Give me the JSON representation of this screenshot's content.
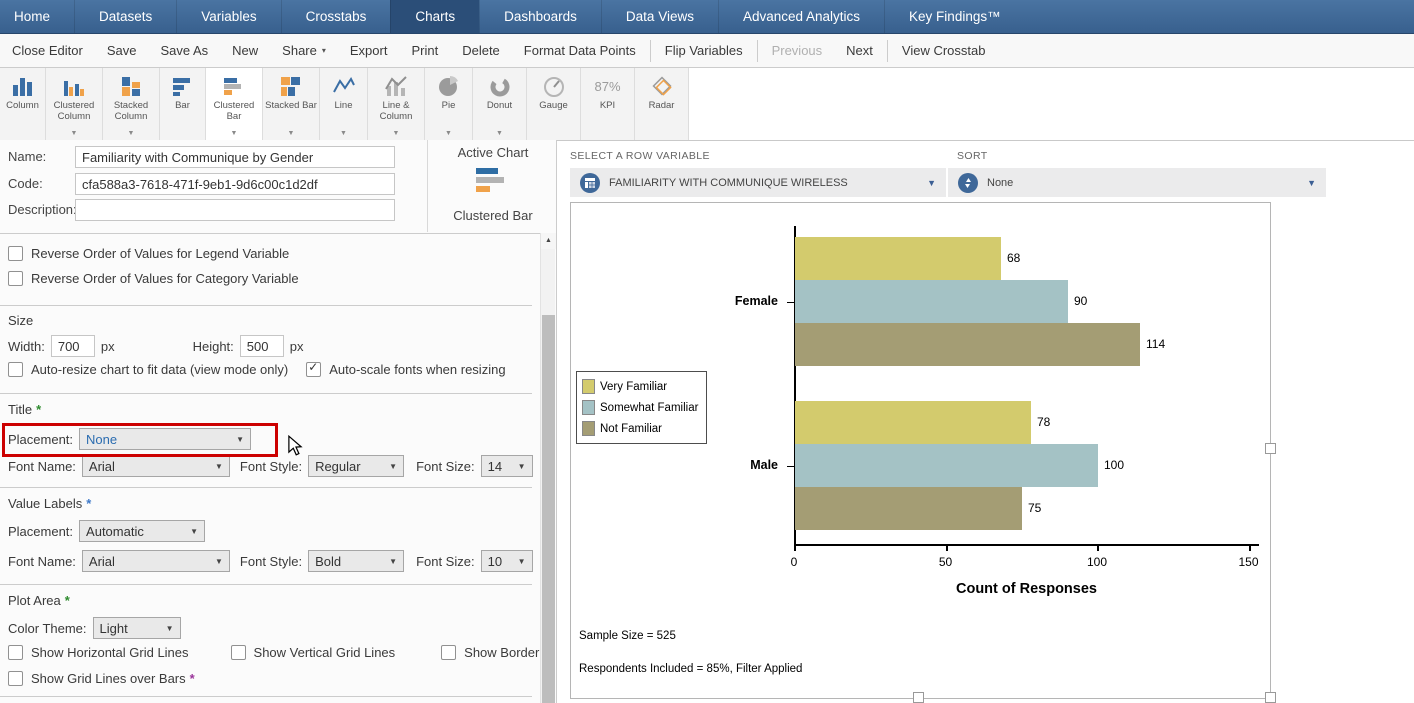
{
  "nav": {
    "items": [
      {
        "label": "Home",
        "active": false
      },
      {
        "label": "Datasets",
        "active": false
      },
      {
        "label": "Variables",
        "active": false
      },
      {
        "label": "Crosstabs",
        "active": false
      },
      {
        "label": "Charts",
        "active": true
      },
      {
        "label": "Dashboards",
        "active": false
      },
      {
        "label": "Data Views",
        "active": false
      },
      {
        "label": "Advanced Analytics",
        "active": false
      },
      {
        "label": "Key Findings™",
        "active": false
      }
    ]
  },
  "menubar": {
    "items": [
      {
        "label": "Close Editor"
      },
      {
        "label": "Save"
      },
      {
        "label": "Save As"
      },
      {
        "label": "New"
      },
      {
        "label": "Share",
        "dropdown": true
      },
      {
        "label": "Export"
      },
      {
        "label": "Print"
      },
      {
        "label": "Delete"
      },
      {
        "label": "Format Data Points"
      },
      {
        "label": "Flip Variables",
        "sep_before": true
      },
      {
        "label": "Previous",
        "disabled": true,
        "sep_before": true
      },
      {
        "label": "Next"
      },
      {
        "label": "View Crosstab",
        "sep_before": true
      }
    ]
  },
  "chart_types": {
    "buttons": [
      {
        "label": "Column",
        "icon": "column-icon",
        "width": 46
      },
      {
        "label": "Clustered Column",
        "icon": "clustered-column-icon",
        "dropdown": true,
        "width": 57
      },
      {
        "label": "Stacked Column",
        "icon": "stacked-column-icon",
        "dropdown": true,
        "width": 57
      },
      {
        "label": "Bar",
        "icon": "bar-icon",
        "width": 46
      },
      {
        "label": "Clustered Bar",
        "icon": "clustered-bar-icon",
        "dropdown": true,
        "selected": true,
        "width": 57
      },
      {
        "label": "Stacked Bar",
        "icon": "stacked-bar-icon",
        "dropdown": true,
        "width": 57
      },
      {
        "label": "Line",
        "icon": "line-icon",
        "dropdown": true,
        "width": 48
      },
      {
        "label": "Line & Column",
        "icon": "line-column-icon",
        "dropdown": true,
        "width": 57
      },
      {
        "label": "Pie",
        "icon": "pie-icon",
        "dropdown": true,
        "width": 48
      },
      {
        "label": "Donut",
        "icon": "donut-icon",
        "dropdown": true,
        "width": 54
      },
      {
        "label": "Gauge",
        "icon": "gauge-icon",
        "width": 54
      },
      {
        "label": "KPI",
        "icon": "kpi-87-icon",
        "kpi_text": "87%",
        "width": 54
      },
      {
        "label": "Radar",
        "icon": "radar-icon",
        "width": 54
      }
    ]
  },
  "properties": {
    "name_label": "Name:",
    "name_value": "Familiarity with Communique by Gender",
    "code_label": "Code:",
    "code_value": "cfa588a3-7618-471f-9eb1-9d6c00c1d2df",
    "description_label": "Description:",
    "description_value": ""
  },
  "active_chart": {
    "title": "Active Chart",
    "name": "Clustered Bar"
  },
  "options": {
    "reverse_legend": "Reverse Order of Values for Legend Variable",
    "reverse_category": "Reverse Order of Values for Category Variable",
    "size_heading": "Size",
    "width_label": "Width:",
    "width_value": "700",
    "width_unit": "px",
    "height_label": "Height:",
    "height_value": "500",
    "height_unit": "px",
    "autoresize_label": "Auto-resize chart to fit data (view mode only)",
    "autoscale_label": "Auto-scale fonts when resizing",
    "required_marker": "*",
    "title_heading": "Title",
    "placement_label": "Placement:",
    "title_placement_value": "None",
    "font_name_label": "Font Name:",
    "font_style_label": "Font Style:",
    "font_size_label": "Font Size:",
    "title_font_name": "Arial",
    "title_font_style": "Regular",
    "title_font_size": "14",
    "value_labels_heading": "Value Labels",
    "vl_placement_value": "Automatic",
    "vl_font_name": "Arial",
    "vl_font_style": "Bold",
    "vl_font_size": "10",
    "plot_area_heading": "Plot Area",
    "color_theme_label": "Color Theme:",
    "color_theme_value": "Light",
    "show_h_grid": "Show Horizontal Grid Lines",
    "show_v_grid": "Show Vertical Grid Lines",
    "show_border": "Show Border",
    "show_grid_over_bars": "Show Grid Lines over Bars"
  },
  "row_variable": {
    "header": "SELECT A ROW VARIABLE",
    "value": "FAMILIARITY WITH COMMUNIQUE WIRELESS",
    "icon": "table-variable-icon"
  },
  "sort": {
    "header": "SORT",
    "value": "None",
    "icon": "sort-arrows-icon"
  },
  "colors": {
    "nav_blue": "#3a608e",
    "nav_active": "#2b4e78",
    "icon_blue": "#3a6ea5",
    "icon_orange": "#f0a24a",
    "highlight_red": "#cc0000"
  },
  "chart_data": {
    "type": "bar",
    "orientation": "horizontal",
    "categories": [
      "Female",
      "Male"
    ],
    "series": [
      {
        "name": "Very Familiar",
        "color": "#d3cb6d",
        "values": [
          68,
          78
        ]
      },
      {
        "name": "Somewhat Familiar",
        "color": "#a4c2c5",
        "values": [
          90,
          100
        ]
      },
      {
        "name": "Not Familiar",
        "color": "#a49d74",
        "values": [
          114,
          75
        ]
      }
    ],
    "xlabel": "Count of Responses",
    "x_ticks": [
      0,
      50,
      100,
      150
    ],
    "xlim": [
      0,
      150
    ],
    "value_labels": true,
    "legend_position": "middle-left",
    "grid": false,
    "footnotes": {
      "sample_size": "Sample Size = 525",
      "respondents": "Respondents Included = 85%, Filter Applied"
    }
  }
}
